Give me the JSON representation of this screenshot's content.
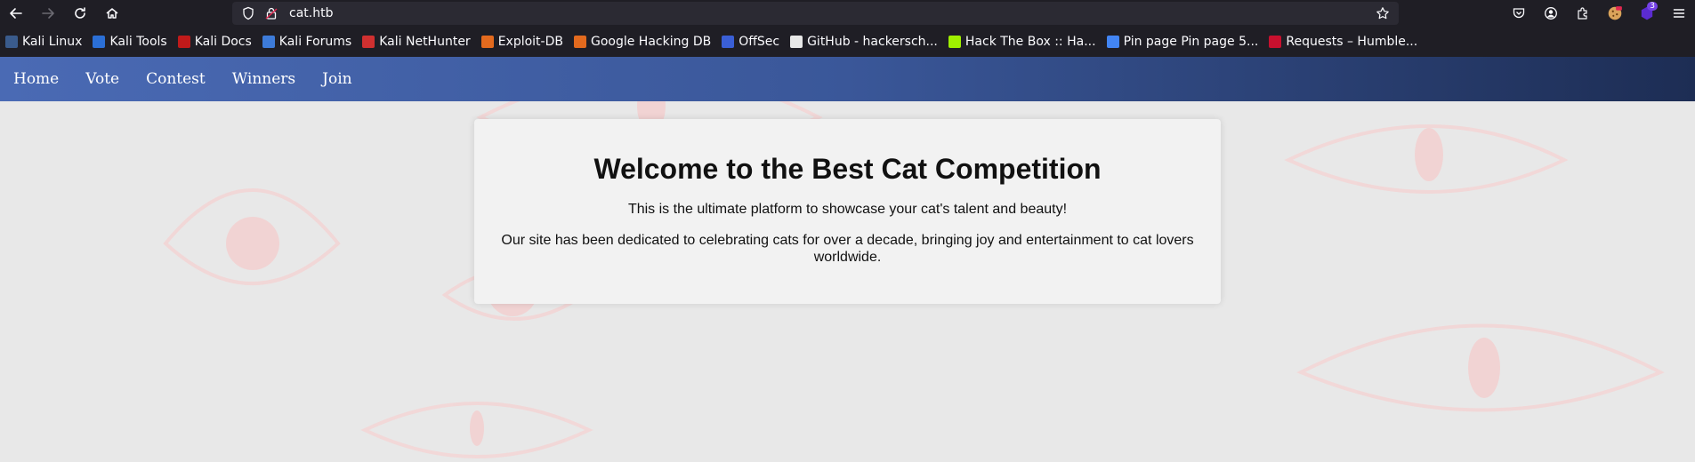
{
  "browser": {
    "url": "cat.htb",
    "extension_badge": "3"
  },
  "bookmarks": [
    {
      "label": "Kali Linux",
      "icon": "kali-dragon-icon",
      "color": "#3a5b8c"
    },
    {
      "label": "Kali Tools",
      "icon": "kali-tools-icon",
      "color": "#2b6fd6"
    },
    {
      "label": "Kali Docs",
      "icon": "kali-docs-icon",
      "color": "#c01a1a"
    },
    {
      "label": "Kali Forums",
      "icon": "kali-forums-icon",
      "color": "#3d7bd9"
    },
    {
      "label": "Kali NetHunter",
      "icon": "nethunter-icon",
      "color": "#d03030"
    },
    {
      "label": "Exploit-DB",
      "icon": "exploitdb-icon",
      "color": "#e36a1e"
    },
    {
      "label": "Google Hacking DB",
      "icon": "ghdb-icon",
      "color": "#e36a1e"
    },
    {
      "label": "OffSec",
      "icon": "offsec-icon",
      "color": "#3a5fd6"
    },
    {
      "label": "GitHub - hackersch...",
      "icon": "github-icon",
      "color": "#e8e8e8"
    },
    {
      "label": "Hack The Box :: Ha...",
      "icon": "htb-icon",
      "color": "#9fef00"
    },
    {
      "label": "Pin page Pin page 5...",
      "icon": "google-icon",
      "color": "#4285f4"
    },
    {
      "label": "Requests – Humble...",
      "icon": "humble-icon",
      "color": "#c8102e"
    }
  ],
  "site_nav": {
    "items": [
      "Home",
      "Vote",
      "Contest",
      "Winners",
      "Join"
    ]
  },
  "main": {
    "title": "Welcome to the Best Cat Competition",
    "paragraph1": "This is the ultimate platform to showcase your cat's talent and beauty!",
    "paragraph2": "Our site has been dedicated to celebrating cats for over a decade, bringing joy and entertainment to cat lovers worldwide."
  },
  "colors": {
    "nav_gradient_start": "#4a6ab4",
    "nav_gradient_end": "#1d2d54",
    "page_bg": "#e8e8e8",
    "card_bg": "#f2f2f2",
    "eye_tint": "#f4c6c6"
  }
}
